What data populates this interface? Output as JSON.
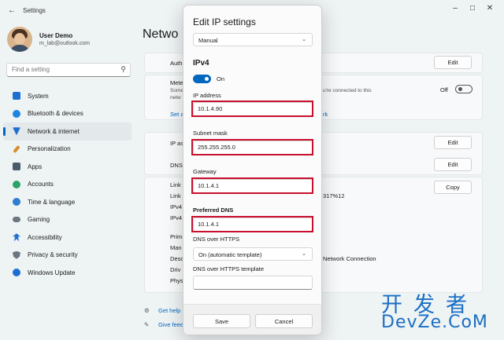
{
  "window": {
    "title": "Settings"
  },
  "user": {
    "name": "User Demo",
    "email": "m_lab@outlook.com"
  },
  "search": {
    "placeholder": "Find a setting"
  },
  "nav": {
    "items": [
      {
        "label": "System",
        "icon": "system-icon",
        "color": "#1f6fd1"
      },
      {
        "label": "Bluetooth & devices",
        "icon": "bluetooth-icon",
        "color": "#1f86e0"
      },
      {
        "label": "Network & internet",
        "icon": "network-icon",
        "color": "#1f6fd1"
      },
      {
        "label": "Personalization",
        "icon": "brush-icon",
        "color": "#d98c2b"
      },
      {
        "label": "Apps",
        "icon": "apps-icon",
        "color": "#4a5b6b"
      },
      {
        "label": "Accounts",
        "icon": "accounts-icon",
        "color": "#2aa36b"
      },
      {
        "label": "Time & language",
        "icon": "time-icon",
        "color": "#2f7fd1"
      },
      {
        "label": "Gaming",
        "icon": "gaming-icon",
        "color": "#6b7780"
      },
      {
        "label": "Accessibility",
        "icon": "accessibility-icon",
        "color": "#1f6fd1"
      },
      {
        "label": "Privacy & security",
        "icon": "shield-icon",
        "color": "#6b7780"
      },
      {
        "label": "Windows Update",
        "icon": "update-icon",
        "color": "#1f6fd1"
      }
    ],
    "active_index": 2
  },
  "background": {
    "page_title": "Netwo",
    "auth_label": "Auth",
    "metered_label": "Mete",
    "metered_sub1": "Some",
    "metered_sub2": "netw",
    "metered_right": "u're connected to this",
    "set_label": "Set a",
    "set_right": "rk",
    "off_label": "Off",
    "ip_label": "IP as",
    "dns_label": "DNS",
    "link1": "Link",
    "link2": "Link",
    "ipv4_a": "IPv4",
    "ipv4_b": "IPv4",
    "ipv6_partial": "317%12",
    "prim": "Prim",
    "man": "Man",
    "desc": "Desc",
    "desc_right": "Network Connection",
    "driv": "Driv",
    "phys": "Phys",
    "edit_label": "Edit",
    "copy_label": "Copy",
    "get_help": "Get help",
    "give_feedback": "Give feed"
  },
  "dialog": {
    "title": "Edit IP settings",
    "mode": "Manual",
    "section": "IPv4",
    "toggle_label": "On",
    "toggle_on": true,
    "ip_label": "IP address",
    "ip_value": "10.1.4.90",
    "subnet_label": "Subnet mask",
    "subnet_value": "255.255.255.0",
    "gateway_label": "Gateway",
    "gateway_value": "10.1.4.1",
    "dns_label": "Preferred DNS",
    "dns_value": "10.1.4.1",
    "doh_label": "DNS over HTTPS",
    "doh_value": "On (automatic template)",
    "doh_template_label": "DNS over HTTPS template",
    "save_label": "Save",
    "cancel_label": "Cancel"
  },
  "watermark": {
    "top": "开发者",
    "bottom": "DevZe.CoM"
  },
  "colors": {
    "accent": "#0067c0",
    "highlight": "#c8102e",
    "watermark": "#1b6fc4"
  }
}
